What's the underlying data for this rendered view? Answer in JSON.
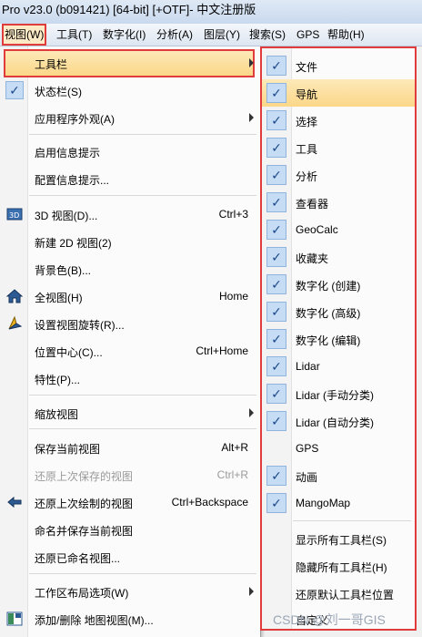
{
  "title": "Pro v23.0 (b091421) [64-bit] [+OTF]- 中文注册版",
  "menubar": [
    "视图(W)",
    "工具(T)",
    "数字化(I)",
    "分析(A)",
    "图层(Y)",
    "搜索(S)",
    "GPS",
    "帮助(H)"
  ],
  "view_menu": {
    "toolbar": "工具栏",
    "statusbar": "状态栏(S)",
    "app_appearance": "应用程序外观(A)",
    "startup_tips": "启用信息提示",
    "config_tips": "配置信息提示...",
    "view3d": "3D 视图(D)...",
    "view3d_sc": "Ctrl+3",
    "new2d": "新建 2D 视图(2)",
    "bgcolor": "背景色(B)...",
    "fullview": "全视图(H)",
    "fullview_sc": "Home",
    "rotate": "设置视图旋转(R)...",
    "center": "位置中心(C)...",
    "center_sc": "Ctrl+Home",
    "props": "特性(P)...",
    "zoom": "缩放视图",
    "save_view": "保存当前视图",
    "save_view_sc": "Alt+R",
    "restore_saved": "还原上次保存的视图",
    "restore_saved_sc": "Ctrl+R",
    "restore_drawn": "还原上次绘制的视图",
    "restore_drawn_sc": "Ctrl+Backspace",
    "name_save": "命名并保存当前视图",
    "restore_named": "还原已命名视图...",
    "workspace": "工作区布局选项(W)",
    "add_remove": "添加/删除 地图视图(M)..."
  },
  "toolbar_menu": {
    "items": [
      "文件",
      "导航",
      "选择",
      "工具",
      "分析",
      "查看器",
      "GeoCalc",
      "收藏夹",
      "数字化 (创建)",
      "数字化 (高级)",
      "数字化 (编辑)",
      "Lidar",
      "Lidar (手动分类)",
      "Lidar (自动分类)",
      "GPS",
      "动画",
      "MangoMap"
    ],
    "show_all": "显示所有工具栏(S)",
    "hide_all": "隐藏所有工具栏(H)",
    "restore_default": "还原默认工具栏位置",
    "custom": "自定义"
  },
  "check_glyph": "✓",
  "watermark": "CSDN @刘一哥GIS"
}
